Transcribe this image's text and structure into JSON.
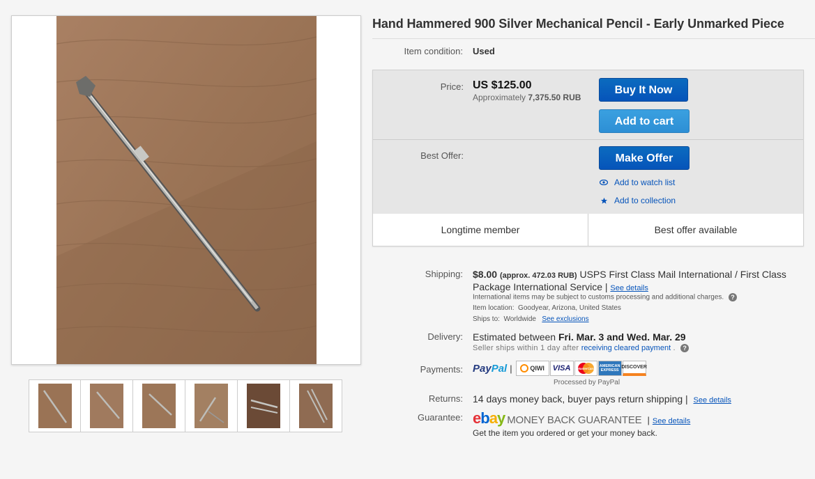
{
  "title": "Hand Hammered 900 Silver Mechanical Pencil - Early Unmarked Piece",
  "condition": {
    "label": "Item condition:",
    "value": "Used"
  },
  "price": {
    "label": "Price:",
    "value": "US $125.00",
    "approx_prefix": "Approximately",
    "approx_value": "7,375.50 RUB"
  },
  "buttons": {
    "buy_now": "Buy It Now",
    "add_to_cart": "Add to cart",
    "make_offer": "Make Offer"
  },
  "best_offer_label": "Best Offer:",
  "links": {
    "watch_list": "Add to watch list",
    "collection": "Add to collection"
  },
  "badges": [
    "Longtime member",
    "Best offer available"
  ],
  "shipping": {
    "label": "Shipping:",
    "cost": "$8.00",
    "approx": "(approx. 472.03 RUB)",
    "service": "USPS First Class Mail International / First Class Package International Service",
    "see_details": "See details",
    "customs_note": "International items may be subject to customs processing and additional charges.",
    "location_label": "Item location:",
    "location_value": "Goodyear, Arizona, United States",
    "ships_to_label": "Ships to:",
    "ships_to_value": "Worldwide",
    "see_exclusions": "See exclusions"
  },
  "delivery": {
    "label": "Delivery:",
    "prefix": "Estimated between",
    "dates": "Fri. Mar. 3 and Wed. Mar. 29",
    "sub_prefix": "Seller ships within 1 day after",
    "sub_link": "receiving cleared payment"
  },
  "payments": {
    "label": "Payments:",
    "paypal_pay": "Pay",
    "paypal_pal": "Pal",
    "cards": [
      "QIWI",
      "VISA",
      "MasterCard",
      "AMERICAN EXPRESS",
      "DISCOVER"
    ],
    "processed": "Processed by PayPal"
  },
  "returns": {
    "label": "Returns:",
    "value": "14 days money back, buyer pays return shipping",
    "see_details": "See details"
  },
  "guarantee": {
    "label": "Guarantee:",
    "logo_e": "e",
    "logo_b": "b",
    "logo_a": "a",
    "logo_y": "y",
    "text": "MONEY BACK GUARANTEE",
    "see_details": "See details",
    "sub": "Get the item you ordered or get your money back."
  },
  "colors": {
    "accent_blue": "#0654ba",
    "button_dark": "#0654ba",
    "button_light": "#2d8fd5",
    "wood": "#a47b5a"
  },
  "thumbnail_count": 6
}
